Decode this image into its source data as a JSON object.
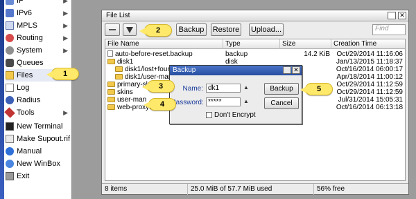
{
  "sidebar": {
    "items": [
      {
        "label": "IP",
        "icon": "ip-icon",
        "arrow": true
      },
      {
        "label": "IPv6",
        "icon": "ipv6-icon",
        "arrow": true
      },
      {
        "label": "MPLS",
        "icon": "mpls-icon",
        "arrow": true
      },
      {
        "label": "Routing",
        "icon": "routing-icon",
        "arrow": true
      },
      {
        "label": "System",
        "icon": "system-icon",
        "arrow": true
      },
      {
        "label": "Queues",
        "icon": "queues-icon",
        "arrow": false
      },
      {
        "label": "Files",
        "icon": "files-icon",
        "arrow": false
      },
      {
        "label": "Log",
        "icon": "log-icon",
        "arrow": false
      },
      {
        "label": "Radius",
        "icon": "radius-icon",
        "arrow": false
      },
      {
        "label": "Tools",
        "icon": "tools-icon",
        "arrow": true
      },
      {
        "label": "New Terminal",
        "icon": "terminal-icon",
        "arrow": false
      },
      {
        "label": "Make Supout.rif",
        "icon": "supout-icon",
        "arrow": false
      },
      {
        "label": "Manual",
        "icon": "manual-icon",
        "arrow": false
      },
      {
        "label": "New WinBox",
        "icon": "winbox-icon",
        "arrow": false
      },
      {
        "label": "Exit",
        "icon": "exit-icon",
        "arrow": false
      }
    ],
    "arrow_glyph": "▶"
  },
  "file_list": {
    "title": "File List",
    "toolbar": {
      "backup": "Backup",
      "restore": "Restore",
      "upload": "Upload...",
      "find_placeholder": "Find"
    },
    "columns": [
      "File Name",
      "Type",
      "Size",
      "Creation Time"
    ],
    "rows": [
      {
        "name": "auto-before-reset.backup",
        "kind": "file",
        "type": "backup",
        "size": "14.2 KiB",
        "time": "Oct/29/2014 11:16:06"
      },
      {
        "name": "disk1",
        "kind": "folder",
        "type": "disk",
        "size": "",
        "time": "Jan/13/2015 11:18:37"
      },
      {
        "name": "disk1/lost+found",
        "kind": "folder",
        "type": "",
        "size": "",
        "time": "Oct/16/2014 06:00:17"
      },
      {
        "name": "disk1/user-man",
        "kind": "folder",
        "type": "",
        "size": "",
        "time": "Apr/18/2014 11:00:12"
      },
      {
        "name": "primary-sla",
        "kind": "folder",
        "type": "",
        "size": "",
        "time": "Oct/29/2014 11:12:59"
      },
      {
        "name": "skins",
        "kind": "folder",
        "type": "",
        "size": "",
        "time": "Oct/29/2014 11:12:59"
      },
      {
        "name": "user-man",
        "kind": "folder",
        "type": "",
        "size": "",
        "time": "Jul/31/2014 15:05:31"
      },
      {
        "name": "web-proxy1",
        "kind": "folder",
        "type": "",
        "size": "",
        "time": "Oct/16/2014 06:13:18"
      }
    ],
    "status": {
      "count": "8 items",
      "usage": "25.0 MiB of 57.7 MiB used",
      "free": "56% free"
    }
  },
  "backup_dialog": {
    "title": "Backup",
    "name_label": "Name:",
    "name_value": "dk1",
    "password_label": "Password:",
    "password_value": "*****",
    "dont_encrypt": "Don't Encrypt",
    "backup_button": "Backup",
    "cancel_button": "Cancel"
  },
  "callouts": [
    "1",
    "2",
    "3",
    "4",
    "5"
  ],
  "colors": {
    "callout": "#ffe96a",
    "dialog_title": "#274e9f",
    "label_blue": "#1a3a9a"
  }
}
